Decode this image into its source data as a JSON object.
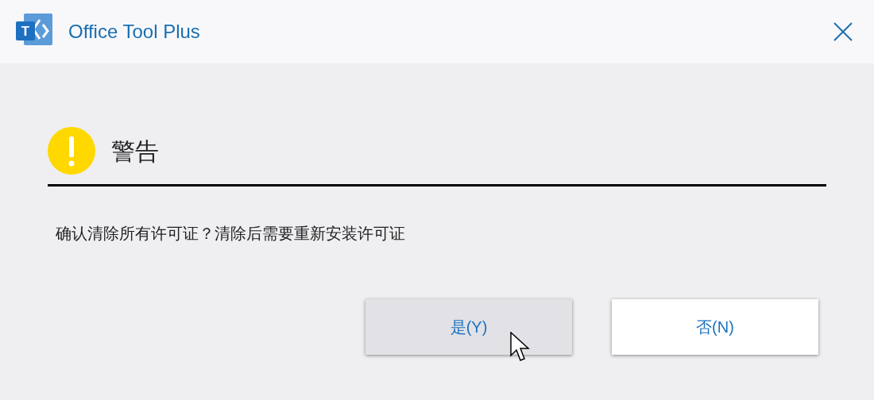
{
  "window": {
    "title": "Office Tool Plus",
    "logo_letter": "T"
  },
  "dialog": {
    "heading": "警告",
    "message": "确认清除所有许可证？清除后需要重新安装许可证"
  },
  "buttons": [
    {
      "label": "是(Y)",
      "hovered": true
    },
    {
      "label": "否(N)",
      "hovered": false
    }
  ]
}
